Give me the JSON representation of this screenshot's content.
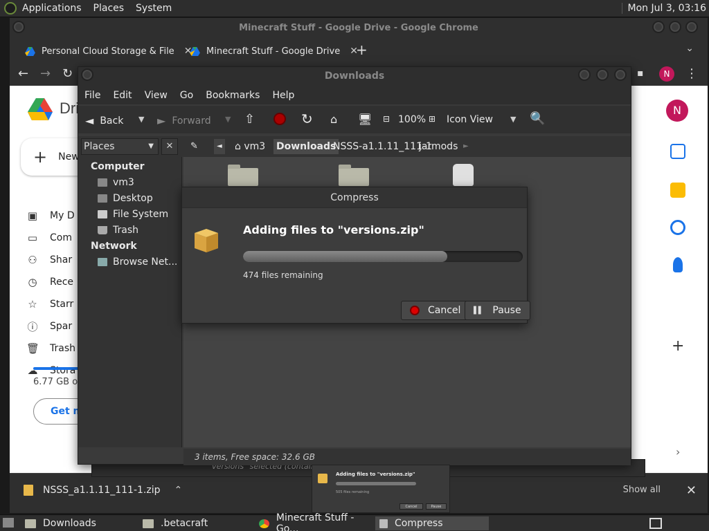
{
  "top_panel": {
    "menus": [
      "Applications",
      "Places",
      "System"
    ],
    "clock": "Mon Jul 3, 03:16"
  },
  "chrome": {
    "title": "Minecraft Stuff - Google Drive - Google Chrome",
    "tabs": [
      {
        "label": "Personal Cloud Storage & File"
      },
      {
        "label": "Minecraft Stuff - Google Drive"
      }
    ],
    "avatar_letter": "N"
  },
  "drive": {
    "logo_word": "Dri",
    "new_label": "New",
    "nav": [
      "My D",
      "Com",
      "Shar",
      "Rece",
      "Starr",
      "Spar",
      "Trash",
      "Stora"
    ],
    "storage_text": "6.77 GB o",
    "get_more": "Get m",
    "rail_avatar": "N"
  },
  "download_shelf": {
    "filename": "NSSS_a1.1.11_111-1.zip",
    "show_all": "Show all"
  },
  "nautilus": {
    "title": "Downloads",
    "menu": [
      "File",
      "Edit",
      "View",
      "Go",
      "Bookmarks",
      "Help"
    ],
    "toolbar": {
      "back": "Back",
      "forward": "Forward",
      "zoom": "100%",
      "view": "Icon View"
    },
    "places_label": "Places",
    "breadcrumbs": [
      "vm3",
      "Downloads",
      "NSSS-a1.1.11_111-1",
      "jarmods"
    ],
    "sidebar": {
      "computer_heading": "Computer",
      "computer_items": [
        "vm3",
        "Desktop",
        "File System",
        "Trash"
      ],
      "network_heading": "Network",
      "network_items": [
        "Browse Net..."
      ]
    },
    "status": "3 items, Free space: 32.6 GB",
    "behind_status": "\"versions\" selected (containing"
  },
  "compress": {
    "title": "Compress",
    "heading": "Adding files to \"versions.zip\"",
    "progress_fraction": 0.73,
    "remaining": "474 files remaining",
    "cancel": "Cancel",
    "pause": "Pause"
  },
  "thumbnail": {
    "title": "Adding files to \"versions.zip\"",
    "remaining": "505 files remaining",
    "cancel": "Cancel",
    "pause": "Pause"
  },
  "taskbar": {
    "items": [
      "Downloads",
      ".betacraft",
      "Minecraft Stuff - Go...",
      "Compress"
    ]
  },
  "colors": {
    "drive_blue": "#1a73e8",
    "avatar_pink": "#c2185b",
    "stop_red": "#dd0000",
    "archive_yellow": "#e8b84a"
  }
}
